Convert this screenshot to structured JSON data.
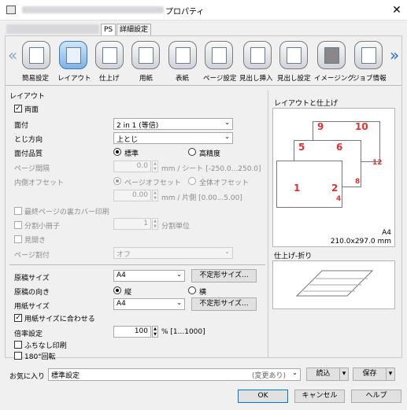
{
  "window": {
    "title_suffix": "プロパティ",
    "close_symbol": "✕"
  },
  "tabs": [
    {
      "label": "PS"
    },
    {
      "label": "詳細設定"
    }
  ],
  "toolbar": {
    "left_arrow": "«",
    "right_arrow": "»",
    "items": [
      {
        "label": "簡易設定",
        "icon": "quick-setup-icon"
      },
      {
        "label": "レイアウト",
        "icon": "layout-icon",
        "selected": true
      },
      {
        "label": "仕上げ",
        "icon": "finishing-icon"
      },
      {
        "label": "用紙",
        "icon": "paper-icon"
      },
      {
        "label": "表紙",
        "icon": "cover-icon"
      },
      {
        "label": "ページ設定",
        "icon": "page-setup-icon"
      },
      {
        "label": "見出し挿入",
        "icon": "tab-insert-icon"
      },
      {
        "label": "見出し設定",
        "icon": "tab-settings-icon"
      },
      {
        "label": "イメージング",
        "icon": "imaging-icon"
      },
      {
        "label": "ジョブ情報",
        "icon": "job-info-icon"
      }
    ]
  },
  "layout": {
    "group_label": "レイアウト",
    "duplex": {
      "label": "両面",
      "checked": true
    },
    "n_up": {
      "label": "面付",
      "value": "2 in 1 (等倍)"
    },
    "binding": {
      "label": "とじ方向",
      "value": "上とじ"
    },
    "quality": {
      "label": "面付品質",
      "opt1": "標準",
      "opt2": "高精度",
      "selected": "標準"
    },
    "page_gap": {
      "label": "ページ間隔",
      "value": "0.0",
      "unit": "mm / シート [-250.0...250.0]"
    },
    "inner_offset": {
      "label": "内側オフセット",
      "opt1": "ページオフセット",
      "opt2": "全体オフセット",
      "value": "0.00",
      "unit": "mm / 片側 [0.00...5.00]"
    },
    "last_page_back": {
      "label": "最終ページの裏カバー印刷"
    },
    "split_booklet": {
      "label": "分割小冊子",
      "value": "1",
      "unit": "分割単位"
    },
    "spread": {
      "label": "見開き"
    },
    "imposition": {
      "label": "ページ割付",
      "value": "オフ"
    }
  },
  "paper": {
    "original_size": {
      "label": "原稿サイズ",
      "value": "A4",
      "button": "不定形サイズ..."
    },
    "orientation": {
      "label": "原稿の向き",
      "opt1": "縦",
      "opt2": "横",
      "selected": "縦"
    },
    "paper_size": {
      "label": "用紙サイズ",
      "value": "A4",
      "button": "不定形サイズ..."
    },
    "fit": {
      "label": "用紙サイズに合わせる",
      "checked": true
    },
    "scale": {
      "label": "倍率設定",
      "value": "100",
      "unit": "% [1...1000]"
    },
    "borderless": {
      "label": "ふちなし印刷",
      "checked": false
    },
    "rotate180": {
      "label": "180°回転",
      "checked": false
    }
  },
  "preview": {
    "layout_title": "レイアウトと仕上げ",
    "page_numbers": [
      "1",
      "2",
      "4",
      "5",
      "6",
      "8",
      "9",
      "10",
      "12"
    ],
    "paper_label": "A4",
    "paper_dims": "210.0x297.0 mm",
    "fold_title": "仕上げ-折り"
  },
  "footer": {
    "favorites_label": "お気に入り",
    "favorites_value": "標準設定",
    "favorites_state": "(変更あり)",
    "load_button": "読込",
    "save_button": "保存",
    "ok_button": "OK",
    "cancel_button": "キャンセル",
    "help_button": "ヘルプ"
  },
  "colors": {
    "accent": "#0078d7",
    "selected_icon": "#7fb2e5",
    "page_number": "#dd3333"
  }
}
